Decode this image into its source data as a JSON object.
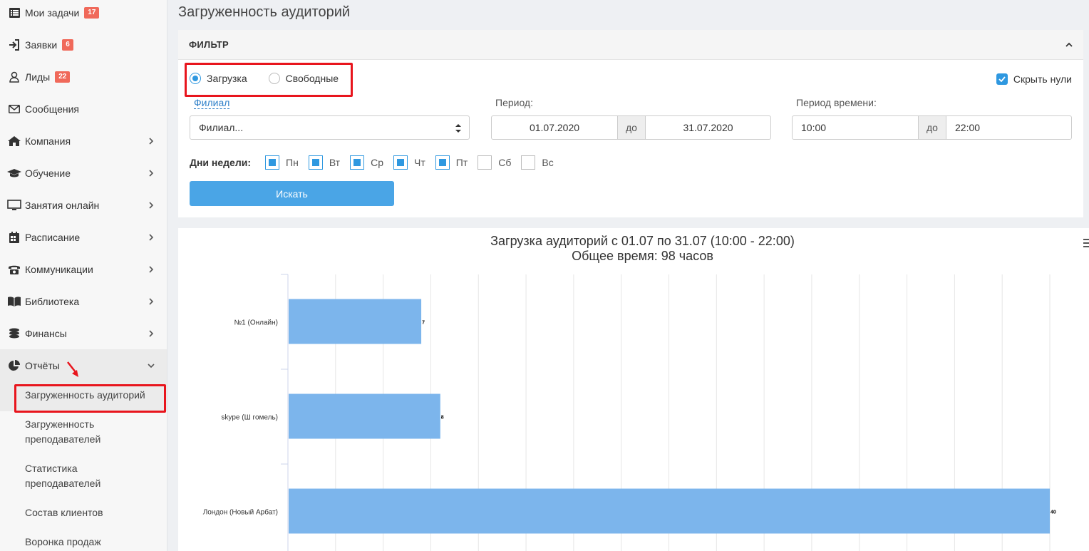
{
  "sidebar": {
    "items": [
      {
        "label": "Мои задачи",
        "badge": "17",
        "icon": "list-icon"
      },
      {
        "label": "Заявки",
        "badge": "6",
        "icon": "sign-in-icon"
      },
      {
        "label": "Лиды",
        "badge": "22",
        "icon": "user-icon"
      },
      {
        "label": "Сообщения",
        "badge": null,
        "icon": "envelope-icon"
      },
      {
        "label": "Компания",
        "icon": "home-icon"
      },
      {
        "label": "Обучение",
        "icon": "graduation-cap-icon"
      },
      {
        "label": "Занятия онлайн",
        "icon": "monitor-icon"
      },
      {
        "label": "Расписание",
        "icon": "calendar-icon"
      },
      {
        "label": "Коммуникации",
        "icon": "phone-icon"
      },
      {
        "label": "Библиотека",
        "icon": "book-icon"
      },
      {
        "label": "Финансы",
        "icon": "coins-icon"
      },
      {
        "label": "Отчёты",
        "icon": "pie-chart-icon"
      }
    ],
    "reports_sub": [
      {
        "label": "Загруженность аудиторий"
      },
      {
        "label": "Загруженность преподавателей"
      },
      {
        "label": "Статистика преподавателей"
      },
      {
        "label": "Состав клиентов"
      },
      {
        "label": "Воронка продаж"
      }
    ]
  },
  "page": {
    "title": "Загруженность аудиторий"
  },
  "filter": {
    "header": "ФИЛЬТР",
    "mode_options": [
      "Загрузка",
      "Свободные"
    ],
    "mode_selected": "Загрузка",
    "hide_zeros_label": "Скрыть нули",
    "hide_zeros_checked": true,
    "branch_label": "Филиал",
    "branch_value": "Филиал...",
    "period_label": "Период:",
    "period_from": "01.07.2020",
    "period_sep": "до",
    "period_to": "31.07.2020",
    "time_label": "Период времени:",
    "time_from": "10:00",
    "time_sep": "до",
    "time_to": "22:00",
    "weekdays_label": "Дни недели:",
    "weekdays": [
      {
        "label": "Пн",
        "checked": true
      },
      {
        "label": "Вт",
        "checked": true
      },
      {
        "label": "Ср",
        "checked": true
      },
      {
        "label": "Чт",
        "checked": true
      },
      {
        "label": "Пт",
        "checked": true
      },
      {
        "label": "Сб",
        "checked": false
      },
      {
        "label": "Вс",
        "checked": false
      }
    ],
    "search_label": "Искать"
  },
  "chart_data": {
    "type": "bar",
    "orientation": "horizontal",
    "title": "Загрузка аудиторий с 01.07 по 31.07 (10:00 - 22:00)",
    "subtitle": "Общее время: 98 часов",
    "categories": [
      "№1 (Онлайн)",
      "skype (Ш гомель)",
      "Лондон (Новый Арбат)"
    ],
    "values": [
      7,
      8,
      40
    ],
    "data_labels": [
      "7",
      "8",
      "40"
    ],
    "xlim": [
      0,
      40
    ],
    "grid": true,
    "bar_color": "#7cb5ec"
  },
  "colors": {
    "accent": "#2f98e0",
    "badge": "#f0695a",
    "highlight": "#e8151d"
  }
}
